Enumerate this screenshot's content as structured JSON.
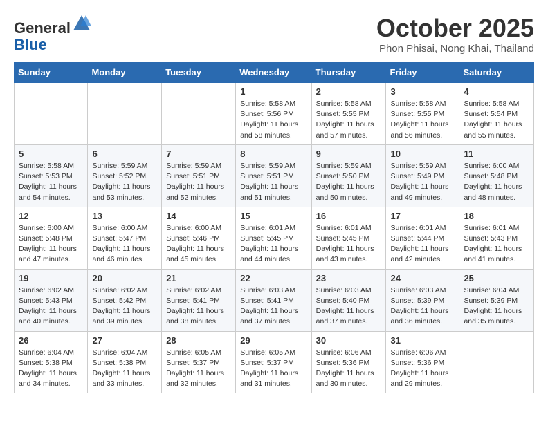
{
  "logo": {
    "general": "General",
    "blue": "Blue"
  },
  "header": {
    "month": "October 2025",
    "location": "Phon Phisai, Nong Khai, Thailand"
  },
  "weekdays": [
    "Sunday",
    "Monday",
    "Tuesday",
    "Wednesday",
    "Thursday",
    "Friday",
    "Saturday"
  ],
  "weeks": [
    [
      {
        "day": "",
        "info": ""
      },
      {
        "day": "",
        "info": ""
      },
      {
        "day": "",
        "info": ""
      },
      {
        "day": "1",
        "info": "Sunrise: 5:58 AM\nSunset: 5:56 PM\nDaylight: 11 hours\nand 58 minutes."
      },
      {
        "day": "2",
        "info": "Sunrise: 5:58 AM\nSunset: 5:55 PM\nDaylight: 11 hours\nand 57 minutes."
      },
      {
        "day": "3",
        "info": "Sunrise: 5:58 AM\nSunset: 5:55 PM\nDaylight: 11 hours\nand 56 minutes."
      },
      {
        "day": "4",
        "info": "Sunrise: 5:58 AM\nSunset: 5:54 PM\nDaylight: 11 hours\nand 55 minutes."
      }
    ],
    [
      {
        "day": "5",
        "info": "Sunrise: 5:58 AM\nSunset: 5:53 PM\nDaylight: 11 hours\nand 54 minutes."
      },
      {
        "day": "6",
        "info": "Sunrise: 5:59 AM\nSunset: 5:52 PM\nDaylight: 11 hours\nand 53 minutes."
      },
      {
        "day": "7",
        "info": "Sunrise: 5:59 AM\nSunset: 5:51 PM\nDaylight: 11 hours\nand 52 minutes."
      },
      {
        "day": "8",
        "info": "Sunrise: 5:59 AM\nSunset: 5:51 PM\nDaylight: 11 hours\nand 51 minutes."
      },
      {
        "day": "9",
        "info": "Sunrise: 5:59 AM\nSunset: 5:50 PM\nDaylight: 11 hours\nand 50 minutes."
      },
      {
        "day": "10",
        "info": "Sunrise: 5:59 AM\nSunset: 5:49 PM\nDaylight: 11 hours\nand 49 minutes."
      },
      {
        "day": "11",
        "info": "Sunrise: 6:00 AM\nSunset: 5:48 PM\nDaylight: 11 hours\nand 48 minutes."
      }
    ],
    [
      {
        "day": "12",
        "info": "Sunrise: 6:00 AM\nSunset: 5:48 PM\nDaylight: 11 hours\nand 47 minutes."
      },
      {
        "day": "13",
        "info": "Sunrise: 6:00 AM\nSunset: 5:47 PM\nDaylight: 11 hours\nand 46 minutes."
      },
      {
        "day": "14",
        "info": "Sunrise: 6:00 AM\nSunset: 5:46 PM\nDaylight: 11 hours\nand 45 minutes."
      },
      {
        "day": "15",
        "info": "Sunrise: 6:01 AM\nSunset: 5:45 PM\nDaylight: 11 hours\nand 44 minutes."
      },
      {
        "day": "16",
        "info": "Sunrise: 6:01 AM\nSunset: 5:45 PM\nDaylight: 11 hours\nand 43 minutes."
      },
      {
        "day": "17",
        "info": "Sunrise: 6:01 AM\nSunset: 5:44 PM\nDaylight: 11 hours\nand 42 minutes."
      },
      {
        "day": "18",
        "info": "Sunrise: 6:01 AM\nSunset: 5:43 PM\nDaylight: 11 hours\nand 41 minutes."
      }
    ],
    [
      {
        "day": "19",
        "info": "Sunrise: 6:02 AM\nSunset: 5:43 PM\nDaylight: 11 hours\nand 40 minutes."
      },
      {
        "day": "20",
        "info": "Sunrise: 6:02 AM\nSunset: 5:42 PM\nDaylight: 11 hours\nand 39 minutes."
      },
      {
        "day": "21",
        "info": "Sunrise: 6:02 AM\nSunset: 5:41 PM\nDaylight: 11 hours\nand 38 minutes."
      },
      {
        "day": "22",
        "info": "Sunrise: 6:03 AM\nSunset: 5:41 PM\nDaylight: 11 hours\nand 37 minutes."
      },
      {
        "day": "23",
        "info": "Sunrise: 6:03 AM\nSunset: 5:40 PM\nDaylight: 11 hours\nand 37 minutes."
      },
      {
        "day": "24",
        "info": "Sunrise: 6:03 AM\nSunset: 5:39 PM\nDaylight: 11 hours\nand 36 minutes."
      },
      {
        "day": "25",
        "info": "Sunrise: 6:04 AM\nSunset: 5:39 PM\nDaylight: 11 hours\nand 35 minutes."
      }
    ],
    [
      {
        "day": "26",
        "info": "Sunrise: 6:04 AM\nSunset: 5:38 PM\nDaylight: 11 hours\nand 34 minutes."
      },
      {
        "day": "27",
        "info": "Sunrise: 6:04 AM\nSunset: 5:38 PM\nDaylight: 11 hours\nand 33 minutes."
      },
      {
        "day": "28",
        "info": "Sunrise: 6:05 AM\nSunset: 5:37 PM\nDaylight: 11 hours\nand 32 minutes."
      },
      {
        "day": "29",
        "info": "Sunrise: 6:05 AM\nSunset: 5:37 PM\nDaylight: 11 hours\nand 31 minutes."
      },
      {
        "day": "30",
        "info": "Sunrise: 6:06 AM\nSunset: 5:36 PM\nDaylight: 11 hours\nand 30 minutes."
      },
      {
        "day": "31",
        "info": "Sunrise: 6:06 AM\nSunset: 5:36 PM\nDaylight: 11 hours\nand 29 minutes."
      },
      {
        "day": "",
        "info": ""
      }
    ]
  ]
}
